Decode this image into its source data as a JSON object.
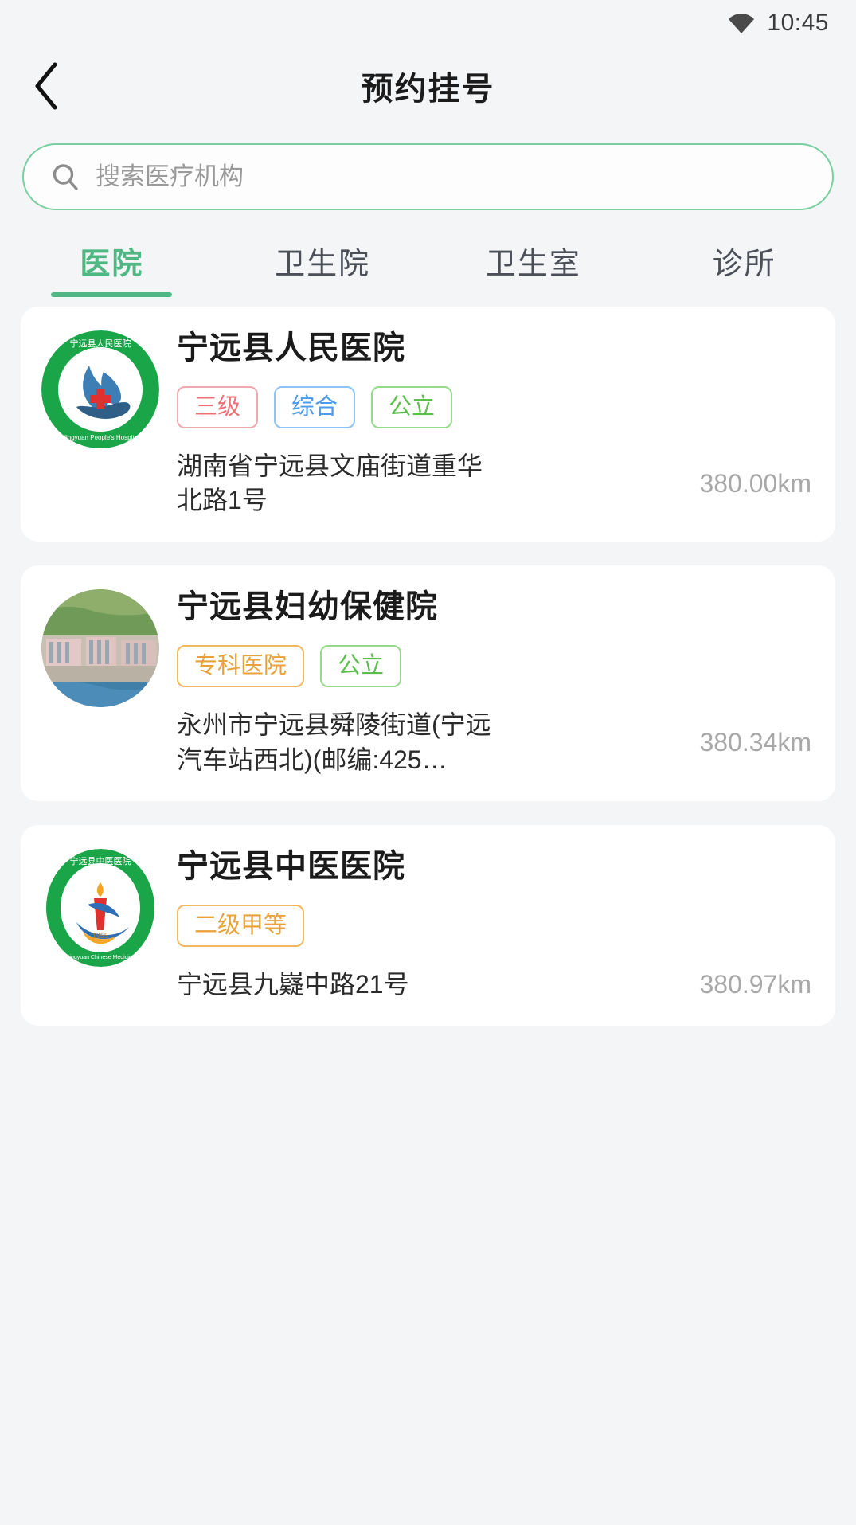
{
  "status_bar": {
    "wifi_icon": "wifi-icon",
    "time": "10:45"
  },
  "nav": {
    "back_icon": "chevron-left-icon",
    "title": "预约挂号"
  },
  "search": {
    "icon": "search-icon",
    "placeholder": "搜索医疗机构",
    "value": ""
  },
  "tabs": [
    {
      "label": "医院",
      "active": true
    },
    {
      "label": "卫生院",
      "active": false
    },
    {
      "label": "卫生室",
      "active": false
    },
    {
      "label": "诊所",
      "active": false
    }
  ],
  "colors": {
    "accent_green": "#4eb783",
    "search_border": "#79cfa0",
    "tag_red": "#ef7077",
    "tag_blue": "#4b9aeb",
    "tag_green": "#5cbf4d",
    "tag_orange": "#e9a13c",
    "page_bg": "#f4f5f7",
    "card_bg": "#ffffff",
    "distance_text": "#a8a8a8"
  },
  "institutions": [
    {
      "name": "宁远县人民医院",
      "logo_name": "ningyuan-peoples-hospital-logo",
      "logo_text_cn": "宁远县人民医院",
      "logo_text_en": "Ningyuan County People's Hospital",
      "tags": [
        {
          "label": "三级",
          "style": "tag-red"
        },
        {
          "label": "综合",
          "style": "tag-blue"
        },
        {
          "label": "公立",
          "style": "tag-green"
        }
      ],
      "address": "湖南省宁远县文庙街道重华北路1号",
      "distance": "380.00km"
    },
    {
      "name": "宁远县妇幼保健院",
      "logo_name": "ningyuan-maternal-child-hospital-photo",
      "logo_text_cn": "",
      "logo_text_en": "",
      "tags": [
        {
          "label": "专科医院",
          "style": "tag-orange"
        },
        {
          "label": "公立",
          "style": "tag-green"
        }
      ],
      "address": "永州市宁远县舜陵街道(宁远汽车站西北)(邮编:425…",
      "distance": "380.34km"
    },
    {
      "name": "宁远县中医医院",
      "logo_name": "ningyuan-chinese-medicine-hospital-logo",
      "logo_text_cn": "宁远县中医医院",
      "logo_text_en": "Ningyuan Chinese Medicine Hospital",
      "logo_year": "1955",
      "tags": [
        {
          "label": "二级甲等",
          "style": "tag-orange"
        }
      ],
      "address": "宁远县九嶷中路21号",
      "distance": "380.97km"
    }
  ]
}
